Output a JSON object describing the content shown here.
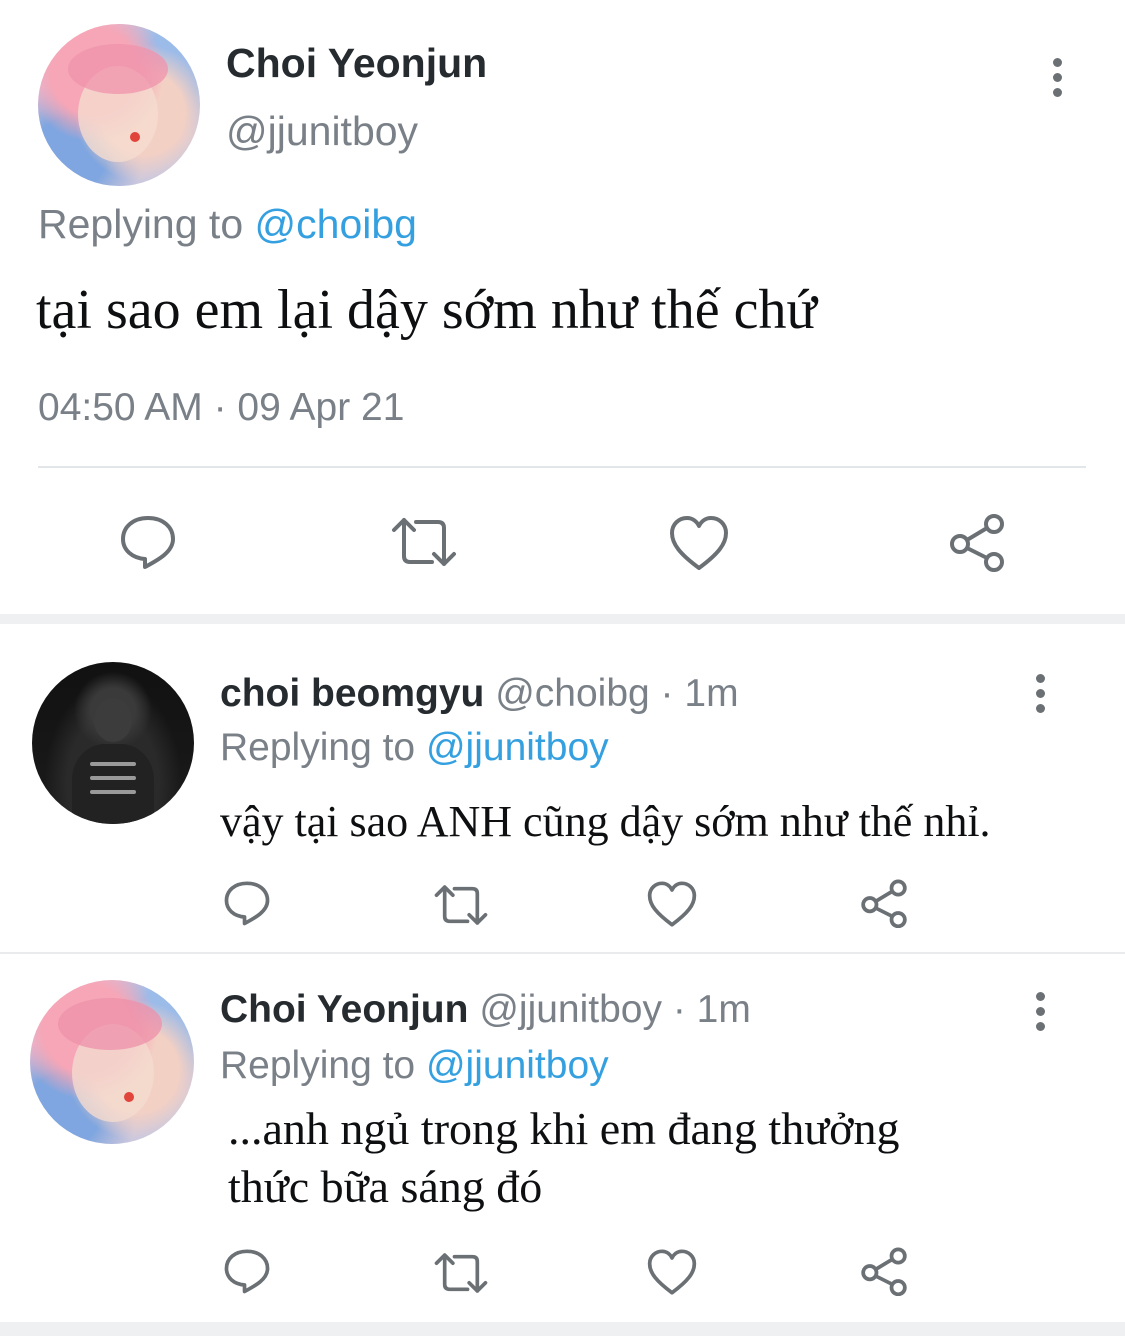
{
  "main_tweet": {
    "author_name": "Choi Yeonjun",
    "handle": "@jjunitboy",
    "replying_prefix": "Replying to",
    "replying_handle": "@choibg",
    "text": "tại sao em lại dậy sớm như thế chứ",
    "timestamp": "04:50 AM · 09 Apr 21"
  },
  "replies": [
    {
      "author_name": "choi beomgyu",
      "handle_time": "@choibg · 1m",
      "replying_prefix": "Replying to",
      "replying_handle": "@jjunitboy",
      "text": "vậy tại sao ANH cũng dậy sớm như thế nhỉ."
    },
    {
      "author_name": "Choi Yeonjun",
      "handle_time": "@jjunitboy · 1m",
      "replying_prefix": "Replying to",
      "replying_handle": "@jjunitboy",
      "text_line1": "...anh ngủ trong khi em đang thưởng",
      "text_line2": "thức bữa sáng đó"
    }
  ],
  "icons": [
    "reply-icon",
    "retweet-icon",
    "like-icon",
    "share-icon",
    "more-options-icon"
  ],
  "colors": {
    "link": "#34a0e0",
    "muted": "#7a8087",
    "icon": "#6b7075"
  }
}
